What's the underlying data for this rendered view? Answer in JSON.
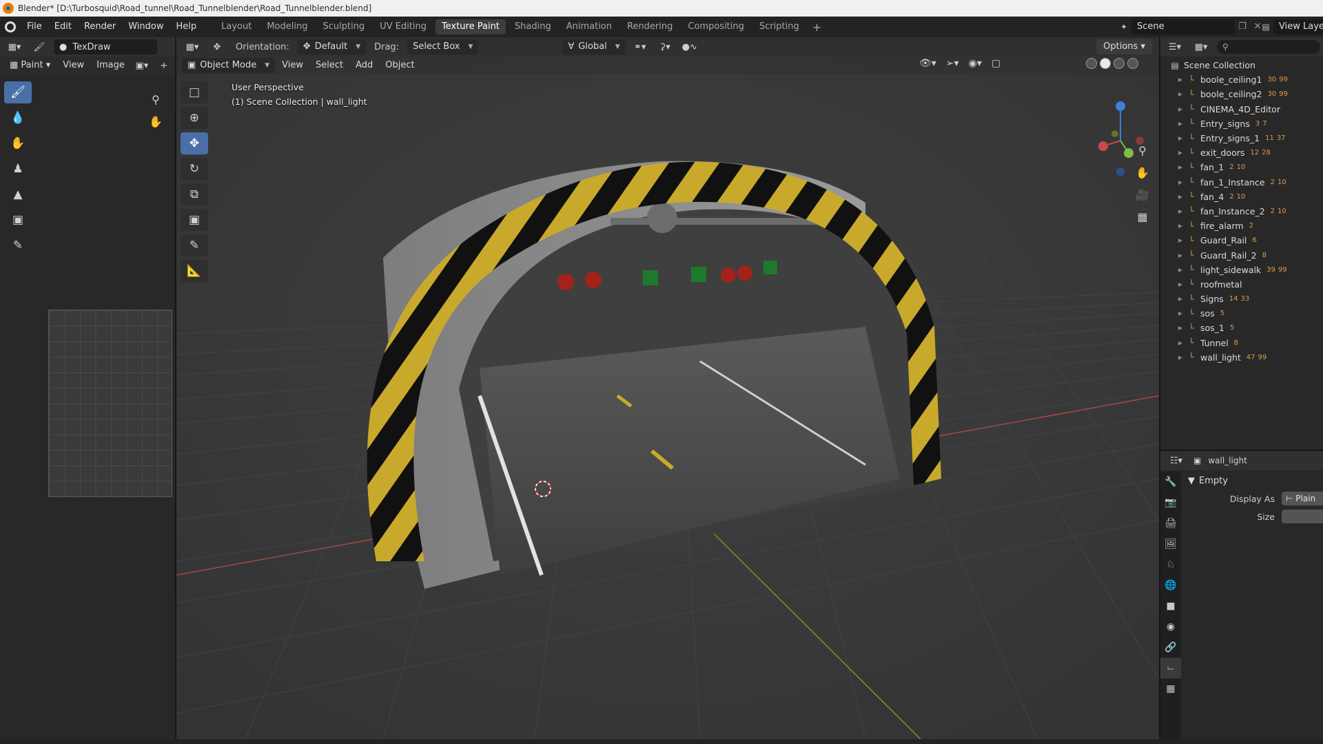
{
  "window": {
    "title": "Blender* [D:\\Turbosquid\\Road_tunnel\\Road_Tunnelblender\\Road_Tunnelblender.blend]"
  },
  "menu": [
    "File",
    "Edit",
    "Render",
    "Window",
    "Help"
  ],
  "workspaces": {
    "tabs": [
      "Layout",
      "Modeling",
      "Sculpting",
      "UV Editing",
      "Texture Paint",
      "Shading",
      "Animation",
      "Rendering",
      "Compositing",
      "Scripting"
    ],
    "active": "Texture Paint",
    "add": "+"
  },
  "scene": {
    "name": "Scene",
    "view_layer": "View Layer"
  },
  "image_editor": {
    "brush": "TexDraw",
    "mode": "Paint",
    "menus": [
      "View",
      "Image"
    ],
    "add": "+"
  },
  "viewport": {
    "orientation_label": "Orientation:",
    "orientation_value": "Default",
    "drag_label": "Drag:",
    "drag_value": "Select Box",
    "transform_space": "Global",
    "options": "Options",
    "mode": "Object Mode",
    "menus": [
      "View",
      "Select",
      "Add",
      "Object"
    ],
    "overlay_line1": "User Perspective",
    "overlay_line2": "(1) Scene Collection | wall_light"
  },
  "outliner": {
    "root": "Scene Collection",
    "items": [
      {
        "name": "boole_ceiling1",
        "b1": "30",
        "b2": "99"
      },
      {
        "name": "boole_ceiling2",
        "b1": "30",
        "b2": "99"
      },
      {
        "name": "CINEMA_4D_Editor",
        "b1": "",
        "b2": ""
      },
      {
        "name": "Entry_signs",
        "b1": "3",
        "b2": "7"
      },
      {
        "name": "Entry_signs_1",
        "b1": "11",
        "b2": "37"
      },
      {
        "name": "exit_doors",
        "b1": "12",
        "b2": "28"
      },
      {
        "name": "fan_1",
        "b1": "2",
        "b2": "10"
      },
      {
        "name": "fan_1_Instance",
        "b1": "2",
        "b2": "10"
      },
      {
        "name": "fan_4",
        "b1": "2",
        "b2": "10"
      },
      {
        "name": "fan_Instance_2",
        "b1": "2",
        "b2": "10"
      },
      {
        "name": "fire_alarm",
        "b1": "",
        "b2": "2"
      },
      {
        "name": "Guard_Rail",
        "b1": "",
        "b2": "6"
      },
      {
        "name": "Guard_Rail_2",
        "b1": "",
        "b2": "8"
      },
      {
        "name": "light_sidewalk",
        "b1": "39",
        "b2": "99"
      },
      {
        "name": "roofmetal",
        "b1": "",
        "b2": ""
      },
      {
        "name": "Signs",
        "b1": "14",
        "b2": "33"
      },
      {
        "name": "sos",
        "b1": "",
        "b2": "5"
      },
      {
        "name": "sos_1",
        "b1": "",
        "b2": "5"
      },
      {
        "name": "Tunnel",
        "b1": "",
        "b2": "8"
      },
      {
        "name": "wall_light",
        "b1": "47",
        "b2": "99"
      }
    ]
  },
  "properties": {
    "object_name": "wall_light",
    "panel": "Empty",
    "display_as_label": "Display As",
    "display_as_value": "Plain",
    "size_label": "Size"
  },
  "colors": {
    "accent": "#4a6fa8",
    "stripe_yellow": "#c9a92b",
    "object_orange": "#e09a4a",
    "axis_x": "#c94a4a",
    "axis_y": "#7fbf3f",
    "axis_z": "#3f7fdf"
  }
}
